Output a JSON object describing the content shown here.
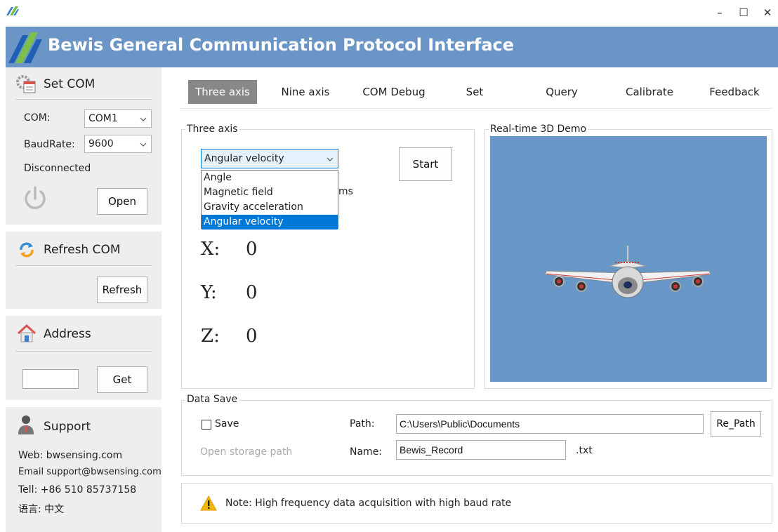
{
  "window": {
    "minimize_glyph": "–",
    "maximize_glyph": "☐",
    "close_glyph": "✕"
  },
  "banner": {
    "title": "Bewis General Communication Protocol Interface"
  },
  "set_com": {
    "title": "Set COM",
    "com_label": "COM:",
    "com_value": "COM1",
    "baud_label": "BaudRate:",
    "baud_value": "9600",
    "status": "Disconnected",
    "open_button": "Open"
  },
  "refresh_com": {
    "title": "Refresh COM",
    "refresh_button": "Refresh"
  },
  "address": {
    "title": "Address",
    "input_value": "",
    "get_button": "Get"
  },
  "support": {
    "title": "Support",
    "web": "Web: bwsensing.com",
    "email": "Email support@bwsensing.com",
    "tel": "Tell:  +86 510 85737158",
    "language": "语言:  中文"
  },
  "tabs": [
    "Three axis",
    "Nine axis",
    "COM Debug",
    "Set",
    "Query",
    "Calibrate",
    "Feedback"
  ],
  "active_tab": "Three axis",
  "three_axis": {
    "group_title": "Three axis",
    "selected_mode": "Angular velocity",
    "options": [
      "Angle",
      "Magnetic field",
      "Gravity acceleration",
      "Angular velocity"
    ],
    "hidden_suffix": "ms",
    "start_button": "Start",
    "x_label": "X:",
    "x_value": "0",
    "y_label": "Y:",
    "y_value": "0",
    "z_label": "Z:",
    "z_value": "0"
  },
  "demo": {
    "title": "Real-time 3D Demo",
    "background_color": "#6796c7"
  },
  "data_save": {
    "title": "Data Save",
    "save_label": "Save",
    "save_checked": false,
    "open_storage": "Open storage path",
    "path_label": "Path:",
    "path_value": "C:\\Users\\Public\\Documents",
    "re_path_button": "Re_Path",
    "name_label": "Name:",
    "name_value": "Bewis_Record",
    "ext": ".txt"
  },
  "note": {
    "text": "Note: High frequency data acquisition with high baud rate"
  },
  "colors": {
    "banner": "#6b95c6",
    "selection": "#0078d7",
    "tab_active": "#888888",
    "warning": "#f5b800"
  }
}
